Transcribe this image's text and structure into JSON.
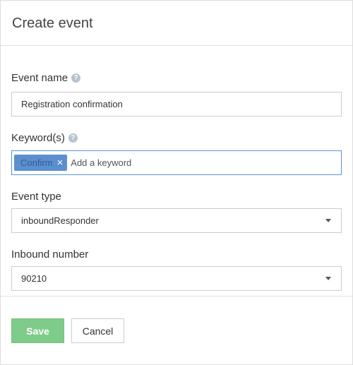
{
  "dialog": {
    "title": "Create event"
  },
  "form": {
    "event_name": {
      "label": "Event name",
      "help_icon": "?",
      "value": "Registration confirmation"
    },
    "keywords": {
      "label": "Keyword(s)",
      "help_icon": "?",
      "tags": [
        {
          "label": "Confirm",
          "remove_icon": "×"
        }
      ],
      "placeholder": "Add a keyword"
    },
    "event_type": {
      "label": "Event type",
      "selected": "inboundResponder"
    },
    "inbound_number": {
      "label": "Inbound number",
      "selected": "90210"
    }
  },
  "footer": {
    "save_label": "Save",
    "cancel_label": "Cancel"
  },
  "colors": {
    "save_button": "#7fcb8a",
    "tag_background": "#5b8fcf",
    "focus_border": "#5a93d1",
    "help_icon": "#b7c3d0"
  },
  "icons": {
    "help": "question-circle-icon",
    "tag_remove": "close-icon",
    "select_caret": "caret-down-icon"
  }
}
